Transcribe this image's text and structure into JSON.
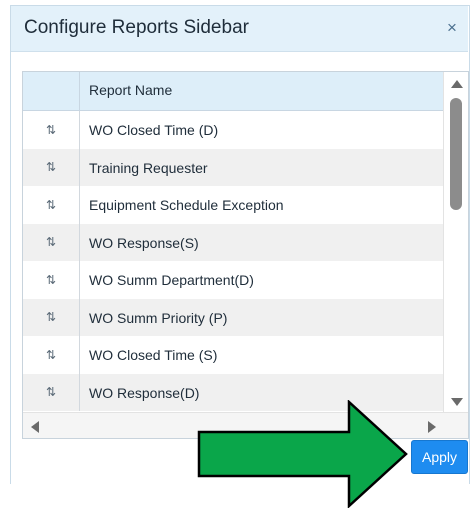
{
  "dialog": {
    "title": "Configure Reports Sidebar",
    "close_glyph": "×"
  },
  "grid": {
    "columns": [
      {
        "key": "drag",
        "label": ""
      },
      {
        "key": "name",
        "label": "Report Name"
      }
    ],
    "drag_glyph": "⇅",
    "rows": [
      {
        "name": "WO Closed Time (D)"
      },
      {
        "name": "Training Requester"
      },
      {
        "name": "Equipment Schedule Exception"
      },
      {
        "name": "WO Response(S)"
      },
      {
        "name": "WO Summ Department(D)"
      },
      {
        "name": "WO Summ Priority (P)"
      },
      {
        "name": "WO Closed Time (S)"
      },
      {
        "name": "WO Response(D)"
      }
    ]
  },
  "actions": {
    "apply_label": "Apply"
  },
  "annotation": {
    "arrow_color": "#0aa64a",
    "arrow_icon": "arrow-right-icon"
  },
  "colors": {
    "header_bg": "#e3f1fa",
    "apply_bg": "#1e8cf0",
    "row_alt_bg": "#f0f0f0"
  }
}
